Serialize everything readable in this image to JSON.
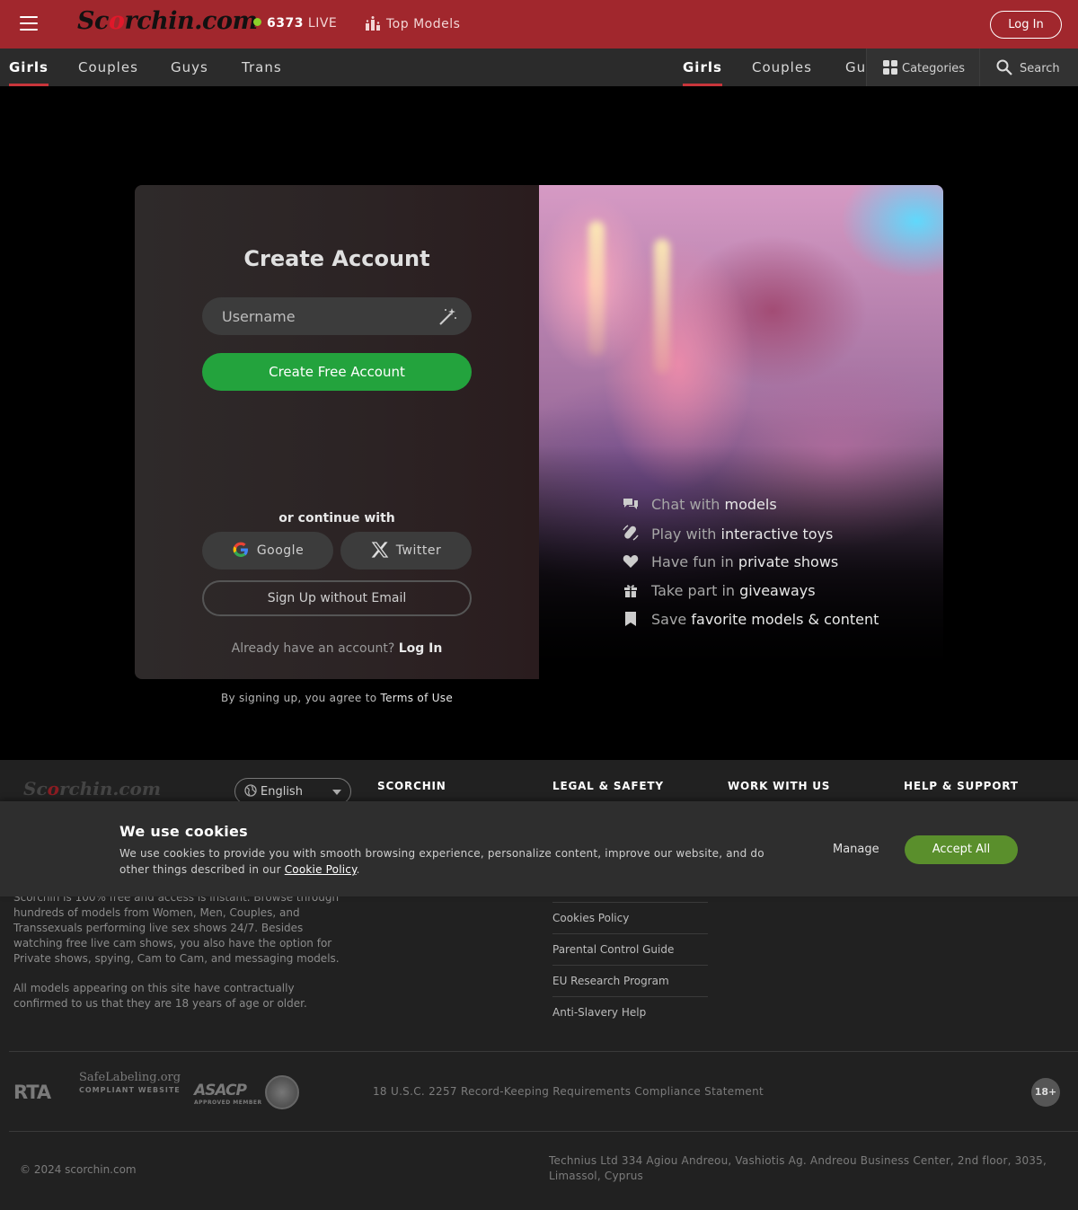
{
  "header": {
    "logo": "Scorchin.com",
    "live_count": "6373",
    "live_label": "LIVE",
    "top_models": "Top Models",
    "login": "Log In"
  },
  "subnav": {
    "tabs": [
      "Girls",
      "Couples",
      "Guys",
      "Trans"
    ],
    "tabs_right": [
      "Girls",
      "Couples",
      "Guys"
    ],
    "categories": "Categories",
    "search": "Search"
  },
  "signup": {
    "title": "Create Account",
    "username_placeholder": "Username",
    "create_button": "Create Free Account",
    "continue_with": "or continue with",
    "google": "Google",
    "twitter": "Twitter",
    "no_email": "Sign Up without Email",
    "already": "Already have an account?",
    "login_link": "Log In",
    "terms_prefix": "By signing up, you agree to",
    "terms_link": "Terms of Use"
  },
  "features": [
    {
      "icon": "chat-icon",
      "pre": "Chat with",
      "bold": "models"
    },
    {
      "icon": "toy-icon",
      "pre": "Play with",
      "bold": "interactive toys"
    },
    {
      "icon": "heart-icon",
      "pre": "Have fun in",
      "bold": "private shows"
    },
    {
      "icon": "gift-icon",
      "pre": "Take part in",
      "bold": "giveaways"
    },
    {
      "icon": "bookmark-icon",
      "pre": "Save",
      "bold": "favorite models & content"
    }
  ],
  "footer": {
    "logo": "Scorchin.com",
    "language": "English",
    "columns": [
      "SCORCHIN",
      "LEGAL & SAFETY",
      "WORK WITH US",
      "HELP & SUPPORT"
    ],
    "about_1": "Scorchin is 100% free and access is instant. Browse through hundreds of models from Women, Men, Couples, and Transsexuals performing live sex shows 24/7. Besides watching free live cam shows, you also have the option for Private shows, spying, Cam to Cam, and messaging models.",
    "about_2": "All models appearing on this site have contractually confirmed to us that they are 18 years of age or older.",
    "legal_links": [
      "Cookies Policy",
      "Parental Control Guide",
      "EU Research Program",
      "Anti-Slavery Help"
    ],
    "badges": [
      "RTA",
      "SafeLabeling.org",
      "COMPLIANT WEBSITE",
      "ASACP",
      "APPROVED MEMBER"
    ],
    "statement": "18 U.S.C. 2257 Record-Keeping Requirements Compliance Statement",
    "age_badge": "18+",
    "copyright": "© 2024 scorchin.com",
    "address": "Technius Ltd 334 Agiou Andreou, Vashiotis Ag. Andreou Business Center, 2nd floor, 3035, Limassol, Cyprus"
  },
  "cookies": {
    "title": "We use cookies",
    "text": "We use cookies to provide you with smooth browsing experience, personalize content, improve our website, and do other things described in our",
    "link": "Cookie Policy",
    "manage": "Manage",
    "accept": "Accept All"
  }
}
